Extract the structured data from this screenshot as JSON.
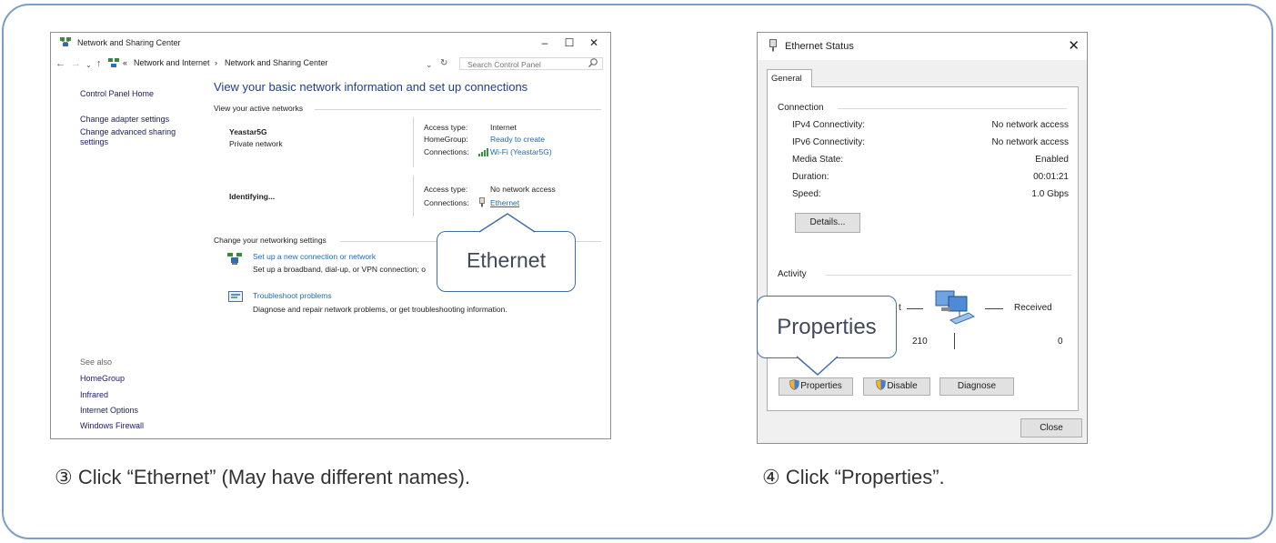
{
  "nsc": {
    "title": "Network and Sharing Center",
    "breadcrumb_prefix": "«",
    "breadcrumb_1": "Network and Internet",
    "breadcrumb_sep": "›",
    "breadcrumb_2": "Network and Sharing Center",
    "search_placeholder": "Search Control Panel",
    "heading": "View your basic network information and set up connections",
    "sidebar": {
      "home": "Control Panel Home",
      "adapter": "Change adapter settings",
      "sharing_1": "Change advanced sharing",
      "sharing_2": "settings",
      "see_also": "See also",
      "homegroup": "HomeGroup",
      "infrared": "Infrared",
      "internet_options": "Internet Options",
      "firewall": "Windows Firewall"
    },
    "active_networks_label": "View your active networks",
    "network1": {
      "name": "Yeastar5G",
      "type": "Private network",
      "access_label": "Access type:",
      "access_value": "Internet",
      "homegroup_label": "HomeGroup:",
      "homegroup_value": "Ready to create",
      "connections_label": "Connections:",
      "connections_value": "Wi-Fi (Yeastar5G)"
    },
    "network2": {
      "name": "Identifying...",
      "access_label": "Access type:",
      "access_value": "No network access",
      "connections_label": "Connections:",
      "connections_value": "Ethernet"
    },
    "change_settings_label": "Change your networking settings",
    "setup": {
      "link": "Set up a new connection or network",
      "desc": "Set up a broadband, dial-up, or VPN connection; o"
    },
    "troubleshoot": {
      "link": "Troubleshoot problems",
      "desc": "Diagnose and repair network problems, or get troubleshooting information."
    }
  },
  "callout_ethernet": "Ethernet",
  "callout_properties": "Properties",
  "eth": {
    "title": "Ethernet Status",
    "tab": "General",
    "connection_label": "Connection",
    "rows": [
      {
        "label": "IPv4 Connectivity:",
        "value": "No network access"
      },
      {
        "label": "IPv6 Connectivity:",
        "value": "No network access"
      },
      {
        "label": "Media State:",
        "value": "Enabled"
      },
      {
        "label": "Duration:",
        "value": "00:01:21"
      },
      {
        "label": "Speed:",
        "value": "1.0 Gbps"
      }
    ],
    "details_button": "Details...",
    "activity_label": "Activity",
    "sent_fragment": "t",
    "received_label": "Received",
    "sent_value": "210",
    "received_value": "0",
    "properties_button": "Properties",
    "disable_button": "Disable",
    "diagnose_button": "Diagnose",
    "close_button": "Close"
  },
  "captions": {
    "left": "③ Click “Ethernet” (May have different names).",
    "right": "④ Click “Properties”."
  },
  "colors": {
    "frame": "#7d9ec6",
    "link_blue": "#1b6cb5",
    "heading_blue": "#1c3f94",
    "callout_border": "#3f6fa6"
  },
  "icons": [
    "network-icon",
    "back-arrow-icon",
    "forward-arrow-icon",
    "up-arrow-icon",
    "refresh-icon",
    "search-icon",
    "wifi-signal-icon",
    "ethernet-plug-icon",
    "shield-icon",
    "computer-network-icon"
  ]
}
